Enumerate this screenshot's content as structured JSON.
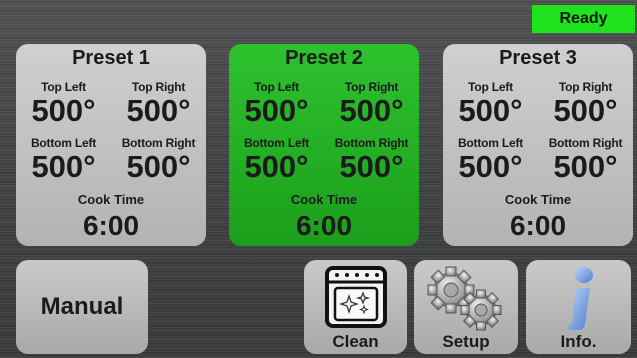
{
  "status": {
    "text": "Ready",
    "color": "#1fe21f"
  },
  "presets": [
    {
      "title": "Preset 1",
      "active": false,
      "top_left_label": "Top Left",
      "top_left_value": "500°",
      "top_right_label": "Top Right",
      "top_right_value": "500°",
      "bottom_left_label": "Bottom Left",
      "bottom_left_value": "500°",
      "bottom_right_label": "Bottom Right",
      "bottom_right_value": "500°",
      "cook_time_label": "Cook Time",
      "cook_time_value": "6:00"
    },
    {
      "title": "Preset 2",
      "active": true,
      "top_left_label": "Top Left",
      "top_left_value": "500°",
      "top_right_label": "Top Right",
      "top_right_value": "500°",
      "bottom_left_label": "Bottom Left",
      "bottom_left_value": "500°",
      "bottom_right_label": "Bottom Right",
      "bottom_right_value": "500°",
      "cook_time_label": "Cook Time",
      "cook_time_value": "6:00"
    },
    {
      "title": "Preset 3",
      "active": false,
      "top_left_label": "Top Left",
      "top_left_value": "500°",
      "top_right_label": "Top Right",
      "top_right_value": "500°",
      "bottom_left_label": "Bottom Left",
      "bottom_left_value": "500°",
      "bottom_right_label": "Bottom Right",
      "bottom_right_value": "500°",
      "cook_time_label": "Cook Time",
      "cook_time_value": "6:00"
    }
  ],
  "buttons": {
    "manual": "Manual",
    "clean": {
      "label": "Clean",
      "icon": "oven-icon"
    },
    "setup": {
      "label": "Setup",
      "icon": "gears-icon"
    },
    "info": {
      "label": "Info.",
      "icon": "info-icon"
    }
  },
  "colors": {
    "active_preset": "#22b022",
    "panel": "#bdbdbd",
    "info_icon": "#6f9fe0"
  }
}
